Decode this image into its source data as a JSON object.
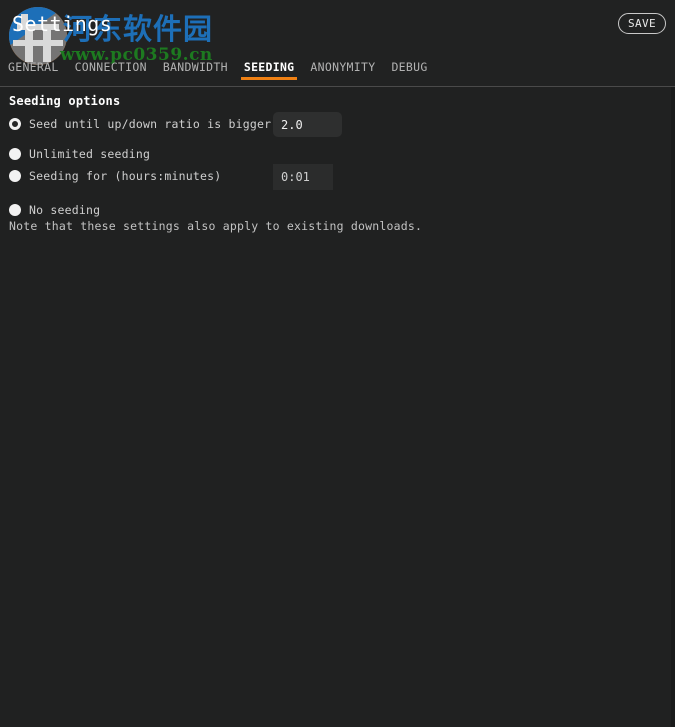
{
  "window": {
    "title": "Settings"
  },
  "header": {
    "save_label": "SAVE"
  },
  "watermark": {
    "site_name": "河东软件园",
    "url": "www.pc0359.cn",
    "logo_blue": "#1d6fb8",
    "logo_orange": "#e07b22",
    "text_blue": "#1d6fb8",
    "url_green": "#1d7a20"
  },
  "tabs": {
    "active_color": "#ef8013",
    "items": [
      {
        "label": "GENERAL",
        "active": false
      },
      {
        "label": "CONNECTION",
        "active": false
      },
      {
        "label": "BANDWIDTH",
        "active": false
      },
      {
        "label": "SEEDING",
        "active": true
      },
      {
        "label": "ANONYMITY",
        "active": false
      },
      {
        "label": "DEBUG",
        "active": false
      }
    ]
  },
  "main": {
    "section_title": "Seeding options",
    "options": [
      {
        "label": "Seed until up/down ratio is bigger than",
        "selected": true
      },
      {
        "label": "Unlimited seeding",
        "selected": false
      },
      {
        "label": "Seeding for (hours:minutes)",
        "selected": false
      },
      {
        "label": "No seeding",
        "selected": false
      }
    ],
    "ratio_value": "2.0",
    "time_value": "0:01",
    "note": "Note that these settings also apply to existing downloads."
  }
}
